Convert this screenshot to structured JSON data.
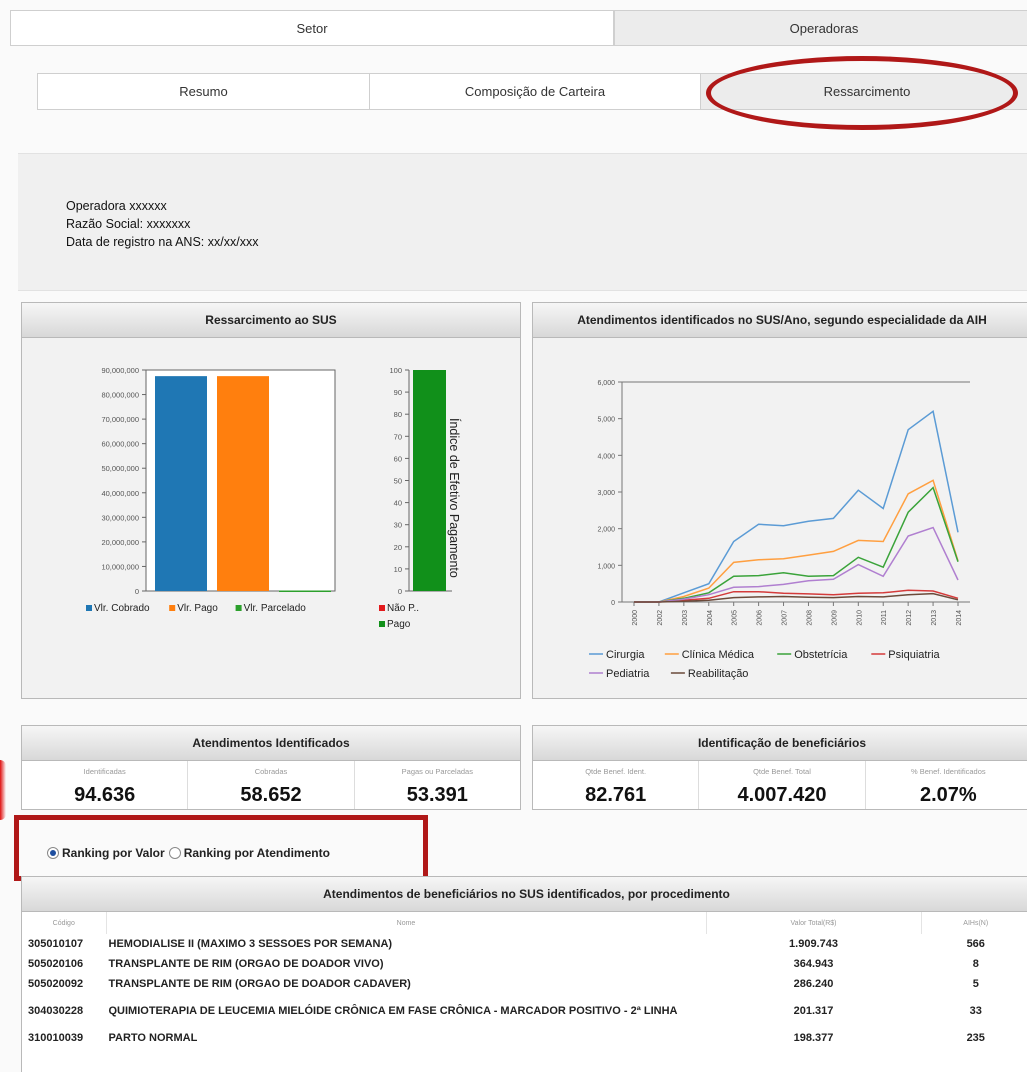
{
  "top_tabs": {
    "setor": "Setor",
    "operadoras": "Operadoras"
  },
  "sub_tabs": [
    "Resumo",
    "Composição de Carteira",
    "Ressarcimento"
  ],
  "operator_info": {
    "line1": "Operadora xxxxxx",
    "line2": "Razão Social: xxxxxxx",
    "line3": "Data de registro na ANS: xx/xx/xxx"
  },
  "ressarcimento_panel": {
    "title": "Ressarcimento ao SUS",
    "chart_data": [
      {
        "type": "bar",
        "categories": [
          "Vlr. Cobrado",
          "Vlr. Pago",
          "Vlr. Parcelado"
        ],
        "values": [
          87500000,
          87500000,
          200000
        ],
        "colors": [
          "#1f77b4",
          "#ff7f0e",
          "#2ca02c"
        ],
        "ylim": [
          0,
          90000000
        ],
        "yticks": [
          "0",
          "10,000,000",
          "20,000,000",
          "30,000,000",
          "40,000,000",
          "50,000,000",
          "60,000,000",
          "70,000,000",
          "80,000,000",
          "90,000,000"
        ],
        "legend": [
          "Vlr. Cobrado",
          "Vlr. Pago",
          "Vlr. Parcelado"
        ]
      },
      {
        "type": "bar",
        "stacked": true,
        "ylabel": "Índice de Efetivo Pagamento",
        "ylim": [
          0,
          100
        ],
        "yticks": [
          "0",
          "10",
          "20",
          "30",
          "40",
          "50",
          "60",
          "70",
          "80",
          "90",
          "100"
        ],
        "series": [
          {
            "name": "Não P..",
            "values": [
              0
            ],
            "color": "#e31a1c"
          },
          {
            "name": "Pago",
            "values": [
              100
            ],
            "color": "#11901a"
          }
        ]
      }
    ]
  },
  "atendimentos_panel": {
    "title": "Atendimentos identificados no SUS/Ano, segundo especialidade da AIH",
    "chart_data": {
      "type": "line",
      "x": [
        "2000",
        "2002",
        "2003",
        "2004",
        "2005",
        "2006",
        "2007",
        "2008",
        "2009",
        "2010",
        "2011",
        "2012",
        "2013",
        "2014"
      ],
      "ylim": [
        0,
        6000
      ],
      "yticks": [
        "0",
        "1,000",
        "2,000",
        "3,000",
        "4,000",
        "5,000",
        "6,000"
      ],
      "series": [
        {
          "name": "Cirurgia",
          "color": "#5b9bd5",
          "values": [
            0,
            0,
            250,
            500,
            1650,
            2120,
            2080,
            2200,
            2280,
            3050,
            2550,
            4700,
            5200,
            1900
          ]
        },
        {
          "name": "Clínica Médica",
          "color": "#ff9f40",
          "values": [
            0,
            0,
            150,
            380,
            1080,
            1150,
            1180,
            1280,
            1380,
            1680,
            1650,
            2950,
            3320,
            1120
          ]
        },
        {
          "name": "Obstetrícia",
          "color": "#3aa33a",
          "values": [
            0,
            0,
            100,
            250,
            700,
            720,
            800,
            700,
            720,
            1220,
            950,
            2450,
            3120,
            1100
          ]
        },
        {
          "name": "Psiquiatria",
          "color": "#d43b3b",
          "values": [
            0,
            0,
            50,
            100,
            280,
            280,
            240,
            220,
            200,
            240,
            250,
            320,
            300,
            100
          ]
        },
        {
          "name": "Pediatria",
          "color": "#b07fd0",
          "values": [
            0,
            0,
            80,
            200,
            400,
            420,
            480,
            580,
            620,
            1020,
            700,
            1800,
            2030,
            600
          ]
        },
        {
          "name": "Reabilitação",
          "color": "#6b4a3a",
          "values": [
            0,
            0,
            20,
            50,
            120,
            140,
            150,
            130,
            120,
            150,
            140,
            200,
            230,
            60
          ]
        }
      ]
    }
  },
  "atendimentos_identificados": {
    "title": "Atendimentos Identificados",
    "stats": [
      {
        "label": "Identificadas",
        "value": "94.636"
      },
      {
        "label": "Cobradas",
        "value": "58.652"
      },
      {
        "label": "Pagas ou Parceladas",
        "value": "53.391"
      }
    ]
  },
  "identificacao_beneficiarios": {
    "title": "Identificação de beneficiários",
    "stats": [
      {
        "label": "Qtde Benef. Ident.",
        "value": "82.761"
      },
      {
        "label": "Qtde Benef. Total",
        "value": "4.007.420"
      },
      {
        "label": "% Benef. Identificados",
        "value": "2.07%"
      }
    ]
  },
  "ranking": {
    "option1": "Ranking por Valor",
    "option2": "Ranking por Atendimento",
    "selected": "option1"
  },
  "procedures_table": {
    "title": "Atendimentos de beneficiários no SUS identificados, por procedimento",
    "columns": [
      "Código",
      "Nome",
      "Valor Total(R$)",
      "AIHs(N)"
    ],
    "rows": [
      {
        "code": "305010107",
        "name": "HEMODIALISE II (MAXIMO 3 SESSOES POR SEMANA)",
        "value": "1.909.743",
        "aih": "566"
      },
      {
        "code": "505020106",
        "name": "TRANSPLANTE DE RIM (ORGAO DE DOADOR VIVO)",
        "value": "364.943",
        "aih": "8"
      },
      {
        "code": "505020092",
        "name": "TRANSPLANTE DE RIM (ORGAO DE DOADOR CADAVER)",
        "value": "286.240",
        "aih": "5"
      },
      {
        "code": "304030228",
        "name": "QUIMIOTERAPIA DE LEUCEMIA MIELÓIDE CRÔNICA EM FASE CRÔNICA - MARCADOR POSITIVO - 2ª LINHA",
        "value": "201.317",
        "aih": "33"
      },
      {
        "code": "310010039",
        "name": "PARTO NORMAL",
        "value": "198.377",
        "aih": "235"
      }
    ]
  }
}
